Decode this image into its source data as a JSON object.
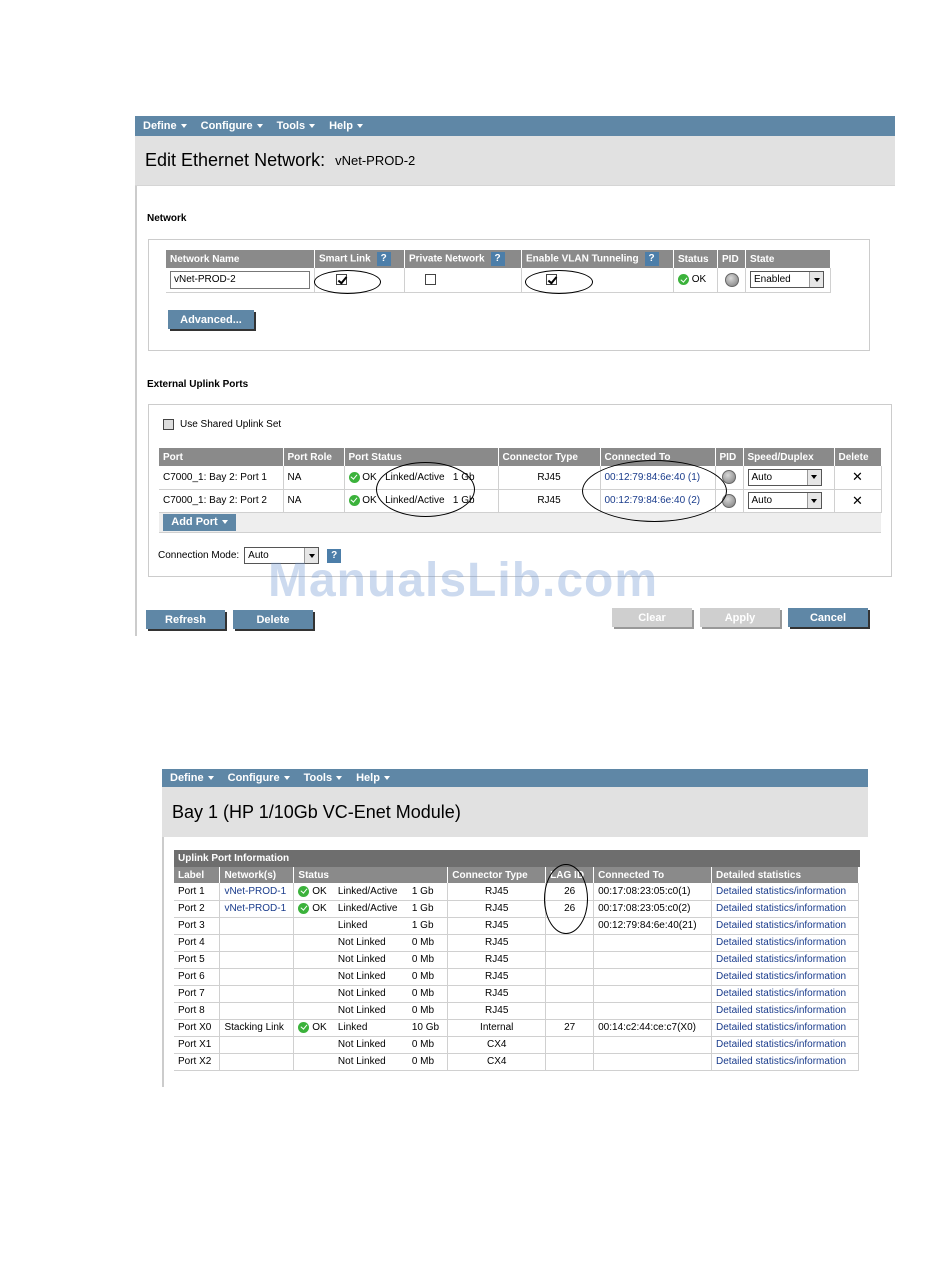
{
  "panel1": {
    "menu": [
      "Define",
      "Configure",
      "Tools",
      "Help"
    ],
    "title": "Edit Ethernet Network:",
    "network_name_value": "vNet-PROD-2",
    "network_section": "Network",
    "network_table": {
      "headers": [
        "Network Name",
        "Smart Link",
        "Private Network",
        "Enable VLAN Tunneling",
        "Status",
        "PID",
        "State"
      ],
      "name_value": "vNet-PROD-2",
      "smart_link": true,
      "private_network": false,
      "vlan_tunneling": true,
      "status": "OK",
      "state": "Enabled",
      "help": "?"
    },
    "advanced_button": "Advanced...",
    "uplink_section": "External Uplink Ports",
    "use_shared_uplink_set": "Use Shared Uplink Set",
    "uplink_table": {
      "headers": [
        "Port",
        "Port Role",
        "Port Status",
        "Connector Type",
        "Connected To",
        "PID",
        "Speed/Duplex",
        "Delete"
      ],
      "rows": [
        {
          "port": "C7000_1: Bay 2: Port 1",
          "role": "NA",
          "ok": "OK",
          "status": "Linked/Active",
          "speed": "1 Gb",
          "connector": "RJ45",
          "connected_to": "00:12:79:84:6e:40 (1)",
          "duplex": "Auto",
          "delete": "✕"
        },
        {
          "port": "C7000_1: Bay 2: Port 2",
          "role": "NA",
          "ok": "OK",
          "status": "Linked/Active",
          "speed": "1 Gb",
          "connector": "RJ45",
          "connected_to": "00:12:79:84:6e:40 (2)",
          "duplex": "Auto",
          "delete": "✕"
        }
      ]
    },
    "add_port_button": "Add Port",
    "connection_mode_label": "Connection Mode:",
    "connection_mode_value": "Auto",
    "buttons": {
      "refresh": "Refresh",
      "delete": "Delete",
      "clear": "Clear",
      "apply": "Apply",
      "cancel": "Cancel"
    }
  },
  "watermark": "ManualsLib.com",
  "panel2": {
    "menu": [
      "Define",
      "Configure",
      "Tools",
      "Help"
    ],
    "title": "Bay 1 (HP 1/10Gb VC-Enet Module)",
    "caption": "Uplink Port Information",
    "headers": [
      "Label",
      "Network(s)",
      "Status",
      "",
      "",
      "Connector Type",
      "LAG ID",
      "Connected To",
      "Detailed statistics"
    ],
    "rows": [
      {
        "label": "Port 1",
        "network": "vNet-PROD-1",
        "ok": "OK",
        "status": "Linked/Active",
        "speed": "1 Gb",
        "connector": "RJ45",
        "lag": "26",
        "connected": "00:17:08:23:05:c0(1)",
        "stats": "Detailed statistics/information"
      },
      {
        "label": "Port 2",
        "network": "vNet-PROD-1",
        "ok": "OK",
        "status": "Linked/Active",
        "speed": "1 Gb",
        "connector": "RJ45",
        "lag": "26",
        "connected": "00:17:08:23:05:c0(2)",
        "stats": "Detailed statistics/information"
      },
      {
        "label": "Port 3",
        "network": "",
        "ok": "",
        "status": "Linked",
        "speed": "1 Gb",
        "connector": "RJ45",
        "lag": "",
        "connected": "00:12:79:84:6e:40(21)",
        "stats": "Detailed statistics/information"
      },
      {
        "label": "Port 4",
        "network": "",
        "ok": "",
        "status": "Not Linked",
        "speed": "0 Mb",
        "connector": "RJ45",
        "lag": "",
        "connected": "",
        "stats": "Detailed statistics/information"
      },
      {
        "label": "Port 5",
        "network": "",
        "ok": "",
        "status": "Not Linked",
        "speed": "0 Mb",
        "connector": "RJ45",
        "lag": "",
        "connected": "",
        "stats": "Detailed statistics/information"
      },
      {
        "label": "Port 6",
        "network": "",
        "ok": "",
        "status": "Not Linked",
        "speed": "0 Mb",
        "connector": "RJ45",
        "lag": "",
        "connected": "",
        "stats": "Detailed statistics/information"
      },
      {
        "label": "Port 7",
        "network": "",
        "ok": "",
        "status": "Not Linked",
        "speed": "0 Mb",
        "connector": "RJ45",
        "lag": "",
        "connected": "",
        "stats": "Detailed statistics/information"
      },
      {
        "label": "Port 8",
        "network": "",
        "ok": "",
        "status": "Not Linked",
        "speed": "0 Mb",
        "connector": "RJ45",
        "lag": "",
        "connected": "",
        "stats": "Detailed statistics/information"
      },
      {
        "label": "Port X0",
        "network": "Stacking Link",
        "ok": "OK",
        "status": "Linked",
        "speed": "10 Gb",
        "connector": "Internal",
        "lag": "27",
        "connected": "00:14:c2:44:ce:c7(X0)",
        "stats": "Detailed statistics/information"
      },
      {
        "label": "Port X1",
        "network": "",
        "ok": "",
        "status": "Not Linked",
        "speed": "0 Mb",
        "connector": "CX4",
        "lag": "",
        "connected": "",
        "stats": "Detailed statistics/information"
      },
      {
        "label": "Port X2",
        "network": "",
        "ok": "",
        "status": "Not Linked",
        "speed": "0 Mb",
        "connector": "CX4",
        "lag": "",
        "connected": "",
        "stats": "Detailed statistics/information"
      }
    ]
  }
}
